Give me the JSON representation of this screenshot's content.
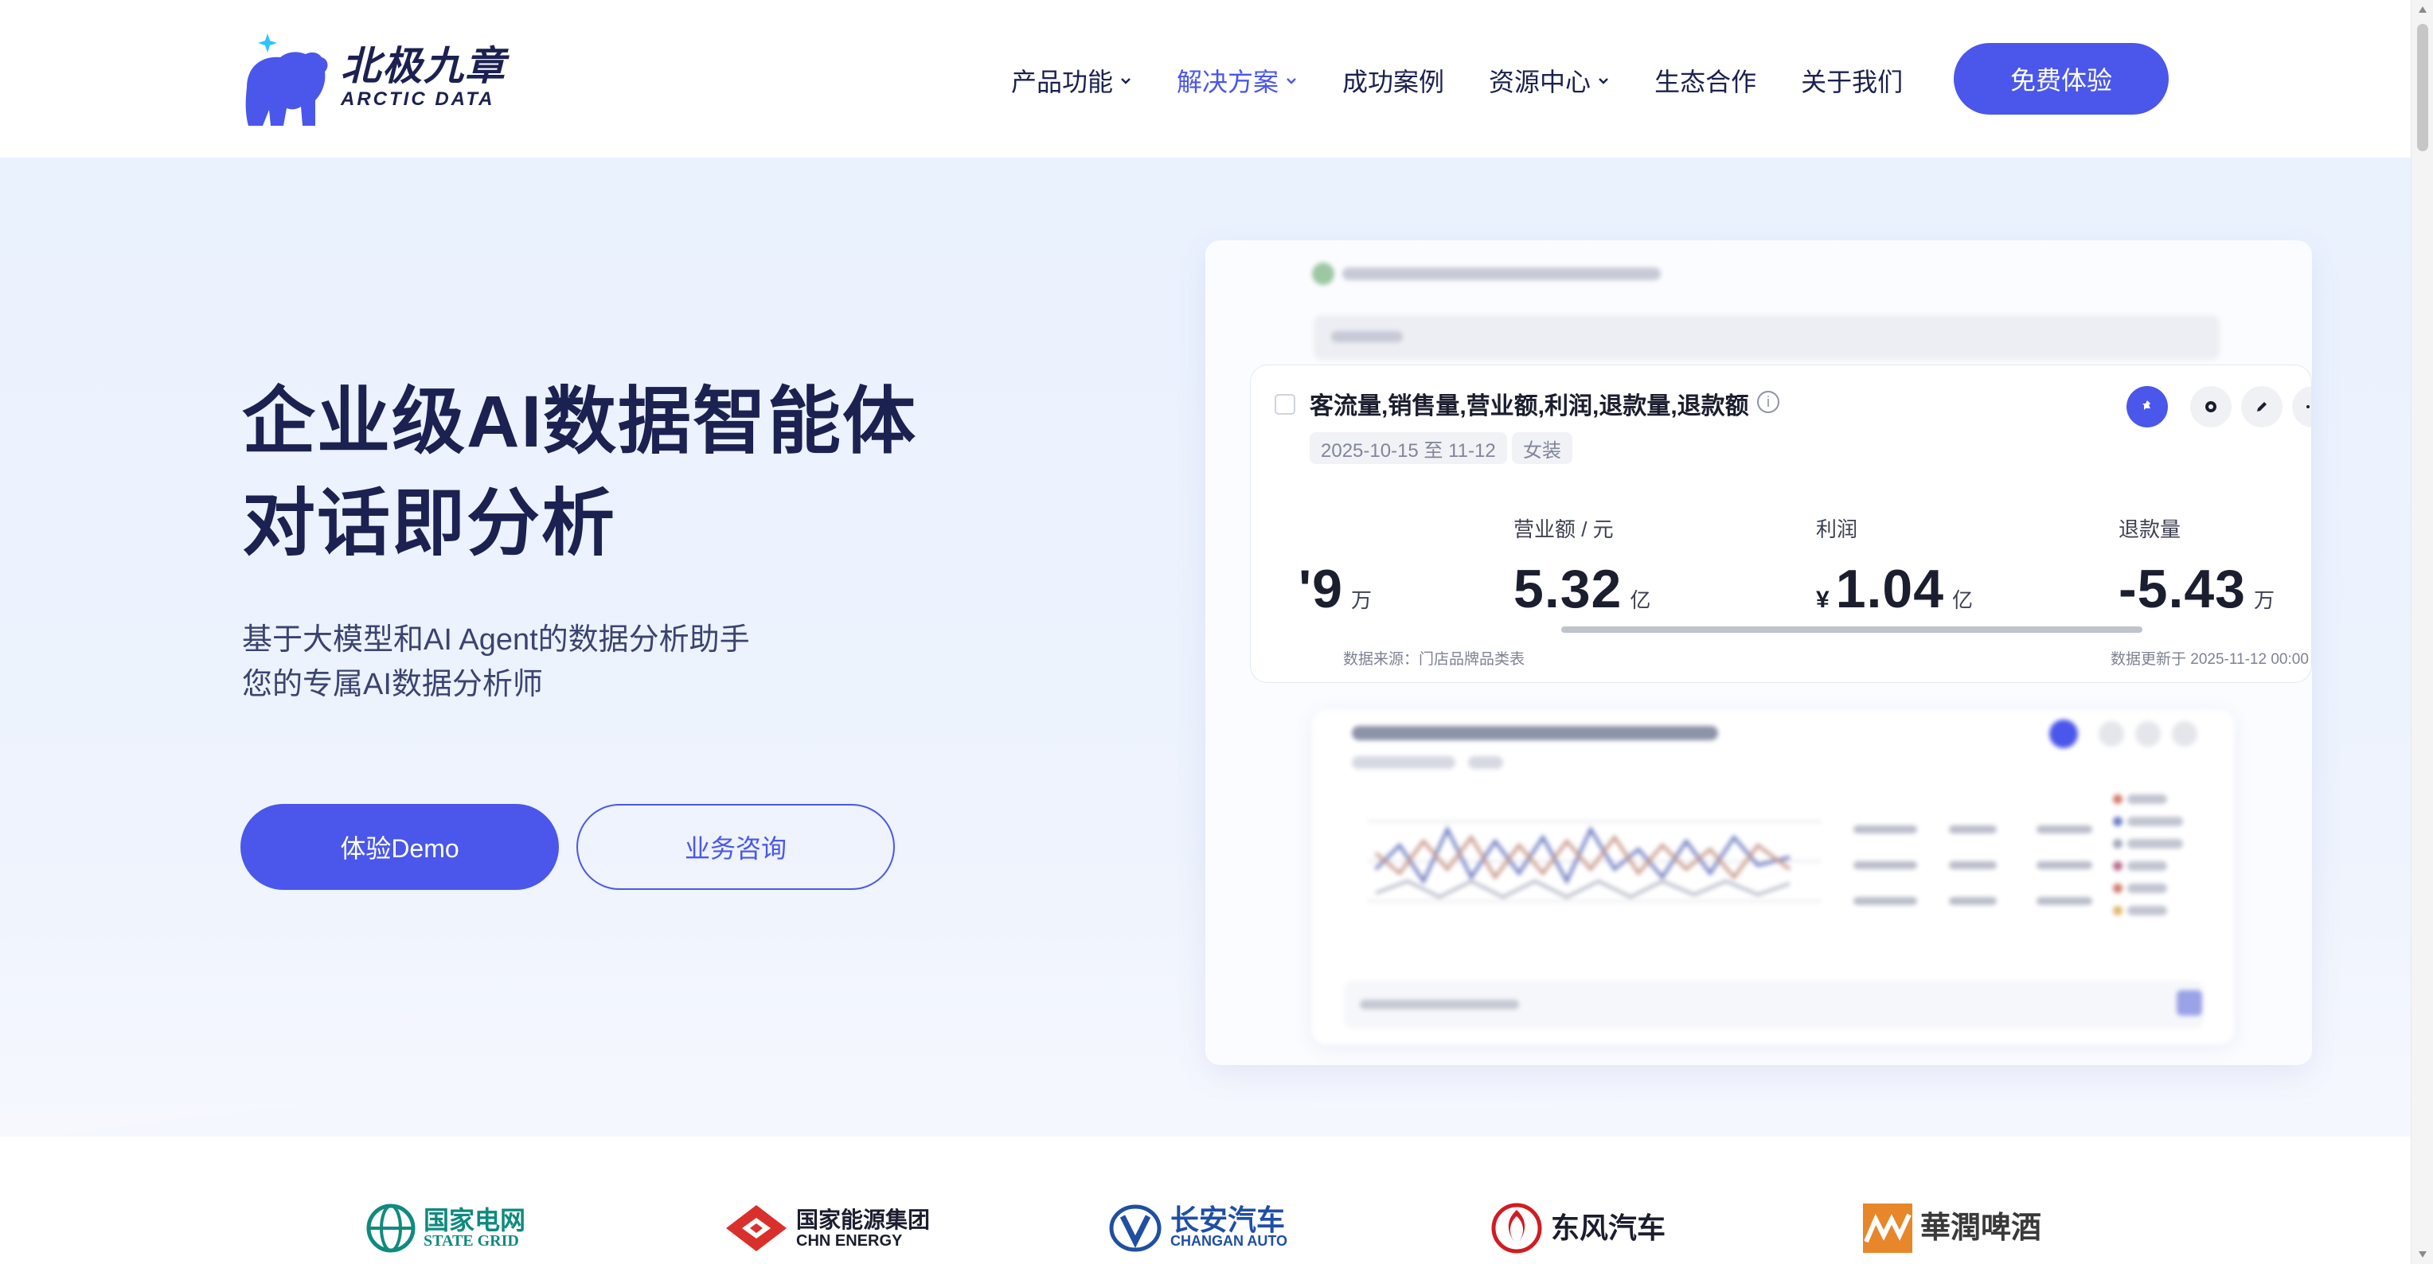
{
  "brand": {
    "name_cn": "北极九章",
    "name_en": "ARCTIC DATA",
    "primary_color": "#4a57ea",
    "ink_color": "#1b2150"
  },
  "nav": {
    "items": [
      {
        "label": "产品功能",
        "has_dropdown": true,
        "active": false
      },
      {
        "label": "解决方案",
        "has_dropdown": true,
        "active": true
      },
      {
        "label": "成功案例",
        "has_dropdown": false,
        "active": false
      },
      {
        "label": "资源中心",
        "has_dropdown": true,
        "active": false
      },
      {
        "label": "生态合作",
        "has_dropdown": false,
        "active": false
      },
      {
        "label": "关于我们",
        "has_dropdown": false,
        "active": false
      }
    ],
    "cta_label": "免费体验"
  },
  "hero": {
    "title_line1": "企业级AI数据智能体",
    "title_line2": "对话即分析",
    "subtitle_line1": "基于大模型和AI Agent的数据分析助手",
    "subtitle_line2": "您的专属AI数据分析师",
    "primary_button": "体验Demo",
    "secondary_button": "业务咨询"
  },
  "preview": {
    "card_title": "客流量,销售量,营业额,利润,退款量,退款额",
    "date_range": "2025-10-15 至 11-12",
    "category_tag": "女装",
    "metrics": [
      {
        "label": "",
        "currency": "",
        "value": "'9",
        "unit": "万"
      },
      {
        "label": "营业额 / 元",
        "currency": "",
        "value": "5.32",
        "unit": "亿"
      },
      {
        "label": "利润",
        "currency": "¥",
        "value": "1.04",
        "unit": "亿"
      },
      {
        "label": "退款量",
        "currency": "",
        "value": "-5.43",
        "unit": "万"
      }
    ],
    "data_source": "数据来源：门店品牌品类表",
    "data_updated": "数据更新于 2025-11-12 00:00"
  },
  "clients": [
    {
      "name_cn": "国家电网",
      "name_en": "STATE GRID",
      "color": "#0f8a7e"
    },
    {
      "name_cn": "国家能源集团",
      "name_en": "CHN ENERGY",
      "color": "#d9302b"
    },
    {
      "name_cn": "长安汽车",
      "name_en": "CHANGAN AUTO",
      "color": "#1f4fa3"
    },
    {
      "name_cn": "东风汽车",
      "name_en": "",
      "color": "#d11c24"
    },
    {
      "name_cn": "華潤啤酒",
      "name_en": "",
      "color": "#e8862a"
    }
  ]
}
